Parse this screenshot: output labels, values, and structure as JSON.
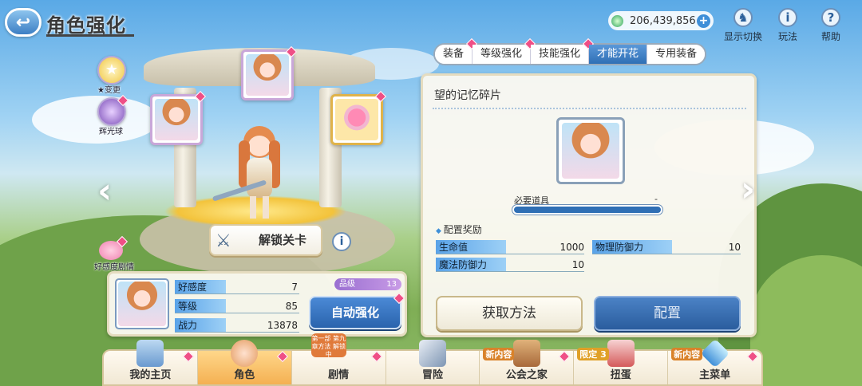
{
  "header": {
    "title": "角色强化",
    "gems": "206,439,856",
    "top_icons": [
      {
        "label": "显示切换",
        "icon": "display-switch-icon",
        "glyph": "♞"
      },
      {
        "label": "玩法",
        "icon": "gameplay-icon",
        "glyph": "i"
      },
      {
        "label": "帮助",
        "icon": "help-icon",
        "glyph": "?"
      }
    ]
  },
  "tabs": [
    {
      "label": "装备",
      "active": false
    },
    {
      "label": "等级强化",
      "active": false
    },
    {
      "label": "技能强化",
      "active": false
    },
    {
      "label": "才能开花",
      "active": true
    },
    {
      "label": "专用装备",
      "active": false
    }
  ],
  "panel": {
    "title": "望的记忆碎片",
    "required_label": "必要道具",
    "required_value": "-",
    "bonus_title": "配置奖励",
    "stats": [
      {
        "label": "生命值",
        "value": "1000"
      },
      {
        "label": "物理防御力",
        "value": "10"
      },
      {
        "label": "魔法防御力",
        "value": "10"
      }
    ],
    "obtain_label": "获取方法",
    "assign_label": "配置"
  },
  "side": {
    "change_label": "★变更",
    "orb_label": "辉光球",
    "unlock_label": "解锁关卡",
    "affection_story_label": "好感度剧情"
  },
  "status": {
    "rows": [
      {
        "label": "好感度",
        "value": "7"
      },
      {
        "label": "等级",
        "value": "85"
      },
      {
        "label": "战力",
        "value": "13878"
      }
    ],
    "rank_label": "品级",
    "rank_value": "13",
    "auto_label": "自动强化"
  },
  "nav": [
    {
      "label": "我的主页",
      "tag": ""
    },
    {
      "label": "角色",
      "tag": ""
    },
    {
      "label": "剧情",
      "tag": "第一部 第九章方法 解锁中"
    },
    {
      "label": "冒险",
      "tag": ""
    },
    {
      "label": "公会之家",
      "tag": "新内容"
    },
    {
      "label": "扭蛋",
      "tag": "限定 3"
    },
    {
      "label": "主菜单",
      "tag": "新内容"
    }
  ],
  "colors": {
    "accent": "#2f6fb5",
    "badge": "#ef4f86",
    "panel_border": "#e5dcc0"
  }
}
